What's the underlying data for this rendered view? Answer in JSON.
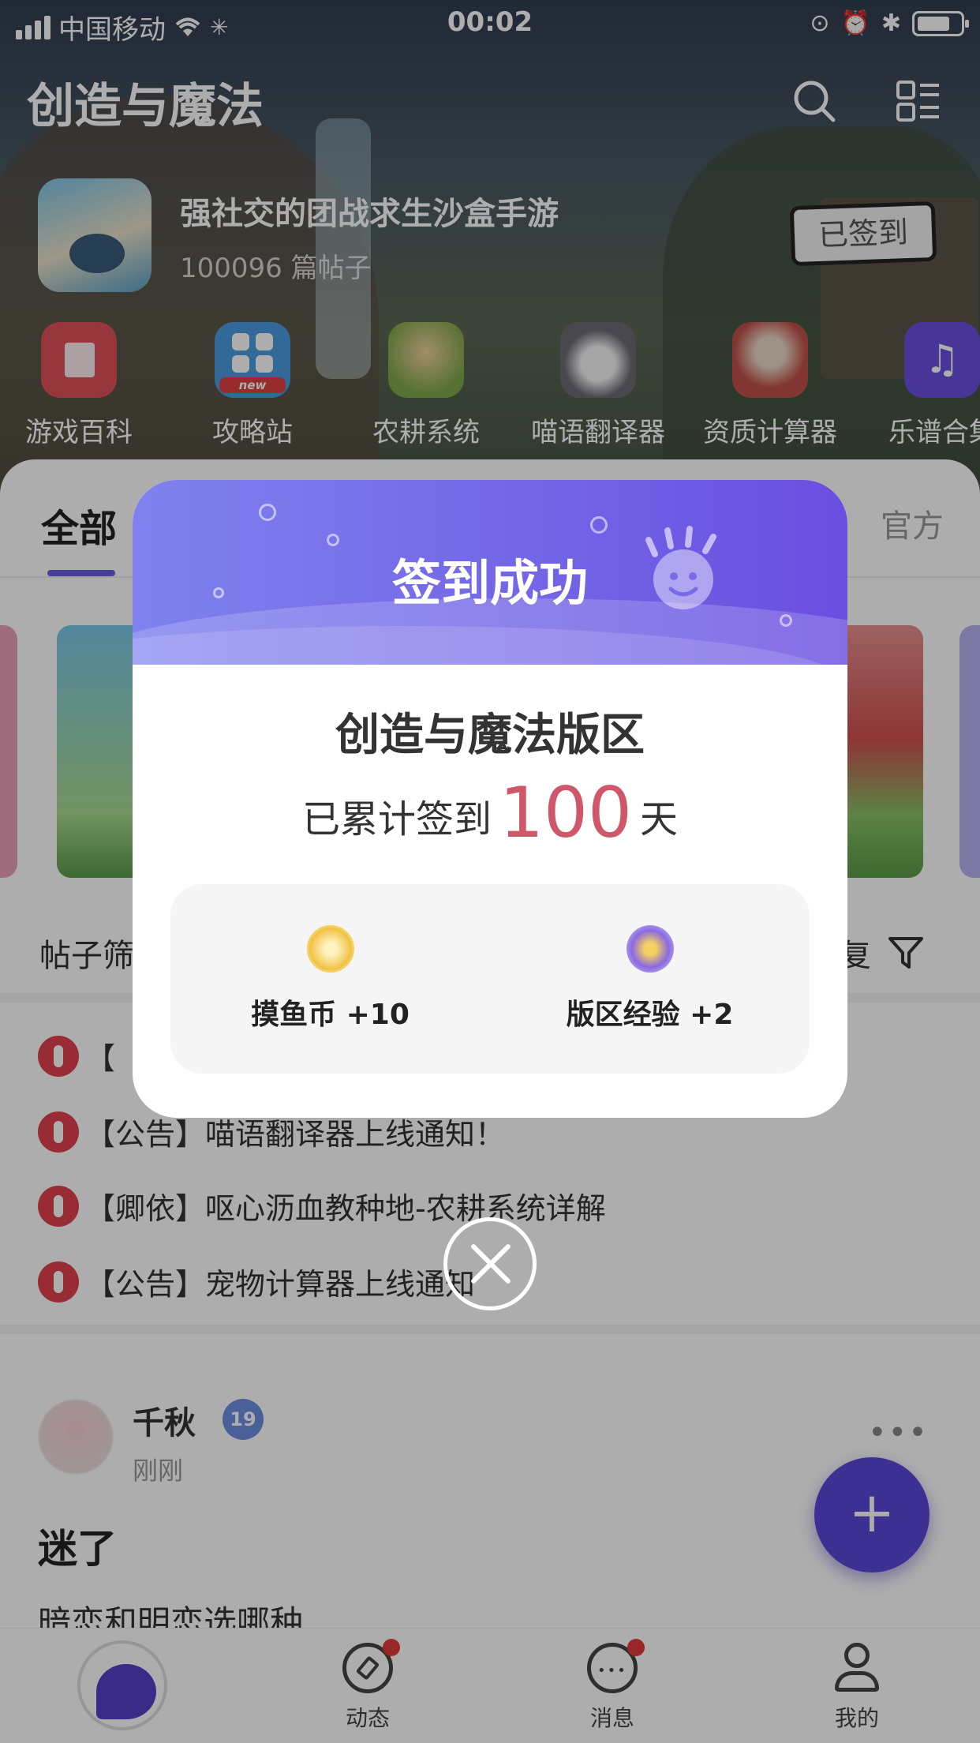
{
  "status_bar": {
    "carrier": "中国移动",
    "time": "00:02"
  },
  "header": {
    "title": "创造与魔法",
    "slogan": "强社交的团战求生沙盒手游",
    "post_count": "100096 篇帖子",
    "checkin_label": "已签到"
  },
  "tools": [
    {
      "label": "游戏百科",
      "icon": "book-icon",
      "color": "#e0505c"
    },
    {
      "label": "攻略站",
      "icon": "grid-new-icon",
      "color": "#4a9be0"
    },
    {
      "label": "农耕系统",
      "icon": "farmer-girl-icon",
      "color": "#7fa84a"
    },
    {
      "label": "喵语翻译器",
      "icon": "cat-icon",
      "color": "#9a9aa8"
    },
    {
      "label": "资质计算器",
      "icon": "dinosaur-icon",
      "color": "#c0504a"
    },
    {
      "label": "乐谱合集",
      "icon": "music-note-icon",
      "color": "#6a4fe0"
    }
  ],
  "tabs": {
    "all": "全部",
    "official": "官方"
  },
  "filter": {
    "left_label": "帖子筛",
    "right_label": "复"
  },
  "notices": [
    "【",
    "【公告】喵语翻译器上线通知！",
    "【卿依】呕心沥血教种地-农耕系统详解",
    "【公告】宠物计算器上线通知"
  ],
  "post": {
    "author": "千秋",
    "level": "19",
    "time": "刚刚",
    "more": "•••",
    "title": "迷了",
    "body": "暗恋和明恋选哪种"
  },
  "fab_label": "+",
  "bottom_nav": {
    "dynamics": "动态",
    "messages": "消息",
    "mine": "我的"
  },
  "modal": {
    "title": "签到成功",
    "forum_name": "创造与魔法版区",
    "count_prefix": "已累计签到",
    "count_value": "100",
    "count_suffix": "天",
    "rewards": [
      {
        "label": "摸鱼币 +10",
        "icon": "fish-coin-icon",
        "color": "#f0c040"
      },
      {
        "label": "版区经验 +2",
        "icon": "star-badge-icon",
        "color": "#8a6ae0"
      }
    ]
  },
  "colors": {
    "accent": "#6a5ce0",
    "count_highlight": "#d0566a",
    "notice_red": "#e0404c"
  }
}
